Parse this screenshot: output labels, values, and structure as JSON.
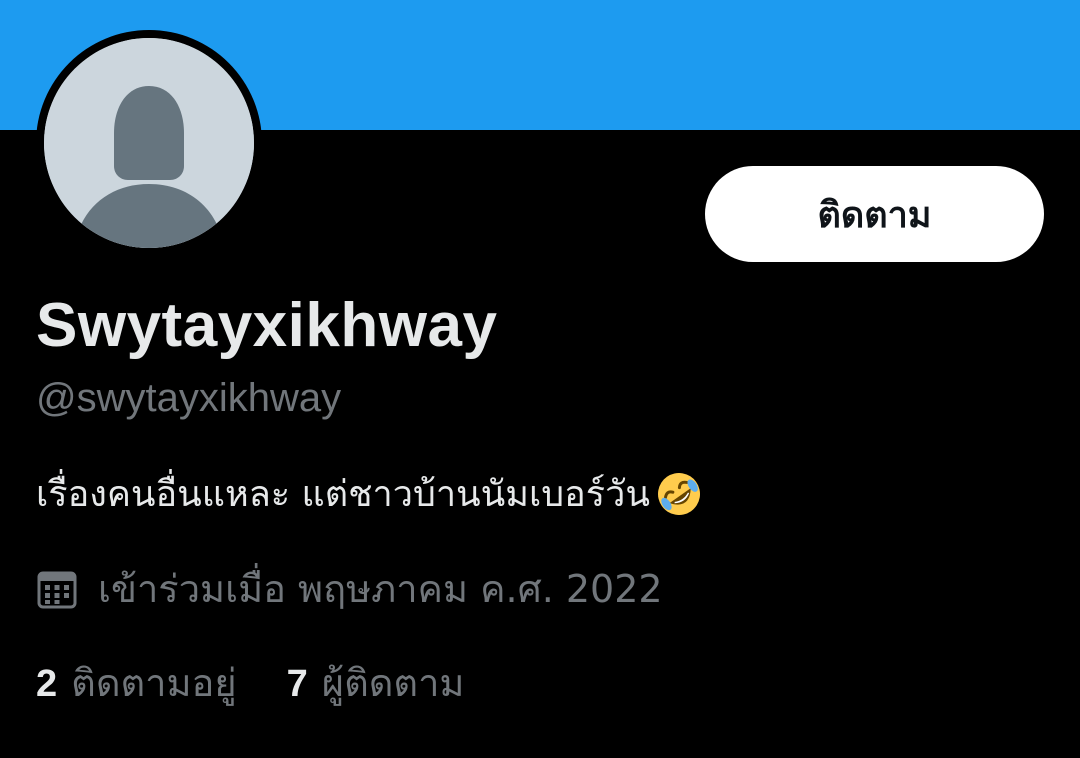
{
  "profile": {
    "display_name": "Swytayxikhway",
    "handle": "@swytayxikhway",
    "bio": "เรื่องคนอื่นแหละ แต่ชาวบ้านนัมเบอร์วัน",
    "bio_emoji": "rolling-on-the-floor-laughing-emoji",
    "joined": "เข้าร่วมเมื่อ พฤษภาคม ค.ศ. 2022",
    "joined_icon": "calendar-icon",
    "avatar_icon": "default-avatar-icon"
  },
  "actions": {
    "follow_label": "ติดตาม"
  },
  "stats": {
    "following_count": "2",
    "following_label": "ติดตามอยู่",
    "followers_count": "7",
    "followers_label": "ผู้ติดตาม"
  },
  "colors": {
    "banner": "#1d9bf0",
    "background": "#000000",
    "primary_text": "#e7e9ea",
    "secondary_text": "#71767b",
    "button_bg": "#ffffff",
    "avatar_bg": "#ccd6dd",
    "avatar_figure": "#66757f"
  }
}
